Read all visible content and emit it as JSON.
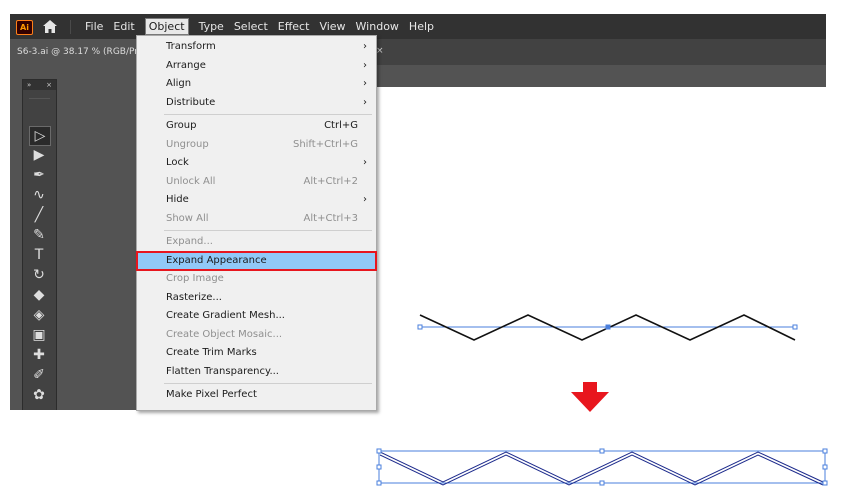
{
  "app": {
    "logo": "Ai",
    "home_icon": "home-icon"
  },
  "menubar": {
    "items": [
      "File",
      "Edit",
      "Object",
      "Type",
      "Select",
      "Effect",
      "View",
      "Window",
      "Help"
    ],
    "active": "Object"
  },
  "document_tab": {
    "title": "S6-3.ai @ 38.17 % (RGB/Pre",
    "close": "×"
  },
  "toolbar": {
    "header": {
      "collapse": "»",
      "close": "×"
    },
    "tools": [
      "selection-tool-icon",
      "direct-selection-tool-icon",
      "pen-tool-icon",
      "curvature-tool-icon",
      "line-segment-tool-icon",
      "paintbrush-tool-icon",
      "type-tool-icon",
      "rotate-tool-icon",
      "eraser-tool-icon",
      "shape-builder-tool-icon",
      "gradient-tool-icon",
      "mesh-tool-icon",
      "eyedropper-tool-icon",
      "symbol-sprayer-tool-icon",
      "graph-tool-icon"
    ]
  },
  "object_menu": {
    "items": [
      {
        "label": "Transform",
        "shortcut": "",
        "submenu": true,
        "enabled": true
      },
      {
        "label": "Arrange",
        "shortcut": "",
        "submenu": true,
        "enabled": true
      },
      {
        "label": "Align",
        "shortcut": "",
        "submenu": true,
        "enabled": true
      },
      {
        "label": "Distribute",
        "shortcut": "",
        "submenu": true,
        "enabled": true
      },
      {
        "label": "Group",
        "shortcut": "Ctrl+G",
        "submenu": false,
        "enabled": true
      },
      {
        "label": "Ungroup",
        "shortcut": "Shift+Ctrl+G",
        "submenu": false,
        "enabled": false
      },
      {
        "label": "Lock",
        "shortcut": "",
        "submenu": true,
        "enabled": true
      },
      {
        "label": "Unlock All",
        "shortcut": "Alt+Ctrl+2",
        "submenu": false,
        "enabled": false
      },
      {
        "label": "Hide",
        "shortcut": "",
        "submenu": true,
        "enabled": true
      },
      {
        "label": "Show All",
        "shortcut": "Alt+Ctrl+3",
        "submenu": false,
        "enabled": false
      },
      {
        "label": "Expand...",
        "shortcut": "",
        "submenu": false,
        "enabled": false
      },
      {
        "label": "Expand Appearance",
        "shortcut": "",
        "submenu": false,
        "enabled": true,
        "highlighted": true
      },
      {
        "label": "Crop Image",
        "shortcut": "",
        "submenu": false,
        "enabled": false
      },
      {
        "label": "Rasterize...",
        "shortcut": "",
        "submenu": false,
        "enabled": true
      },
      {
        "label": "Create Gradient Mesh...",
        "shortcut": "",
        "submenu": false,
        "enabled": true
      },
      {
        "label": "Create Object Mosaic...",
        "shortcut": "",
        "submenu": false,
        "enabled": false
      },
      {
        "label": "Create Trim Marks",
        "shortcut": "",
        "submenu": false,
        "enabled": true
      },
      {
        "label": "Flatten Transparency...",
        "shortcut": "",
        "submenu": false,
        "enabled": true
      },
      {
        "label": "Make Pixel Perfect",
        "shortcut": "",
        "submenu": false,
        "enabled": true
      }
    ]
  },
  "colors": {
    "highlight": "#91c9f7",
    "highlight_border": "#e8161e",
    "arrow": "#e8161e",
    "path_selection": "#4a7fdc",
    "expanded_stroke": "#1c2a8c"
  }
}
